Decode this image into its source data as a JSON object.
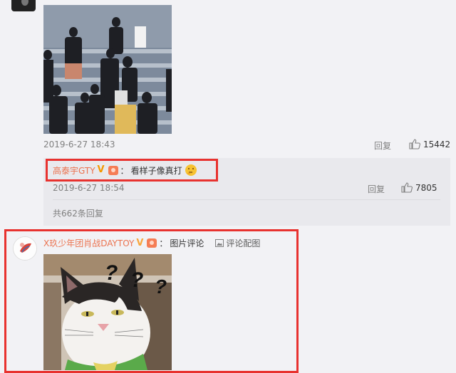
{
  "post1": {
    "timestamp": "2019-6-27 18:43",
    "reply_label": "回复",
    "like_count": "15442"
  },
  "sub_reply": {
    "user": "高泰宇GTY",
    "separator": "：",
    "text": "看样子像真打",
    "emoji": "thinking-face",
    "timestamp": "2019-6-27 18:54",
    "reply_label": "回复",
    "like_count": "7805",
    "total_replies": "共662条回复"
  },
  "post2": {
    "user": "X玖少年团肖战DAYTOY",
    "separator": "：",
    "text": "图片评论",
    "image_link": "评论配图",
    "overlay_text": [
      "?",
      "?",
      "?"
    ]
  },
  "colors": {
    "highlight": "#e8322f",
    "username": "#eb7350",
    "page_bg": "#f2f2f5",
    "reply_bg": "#e9e9ed"
  }
}
